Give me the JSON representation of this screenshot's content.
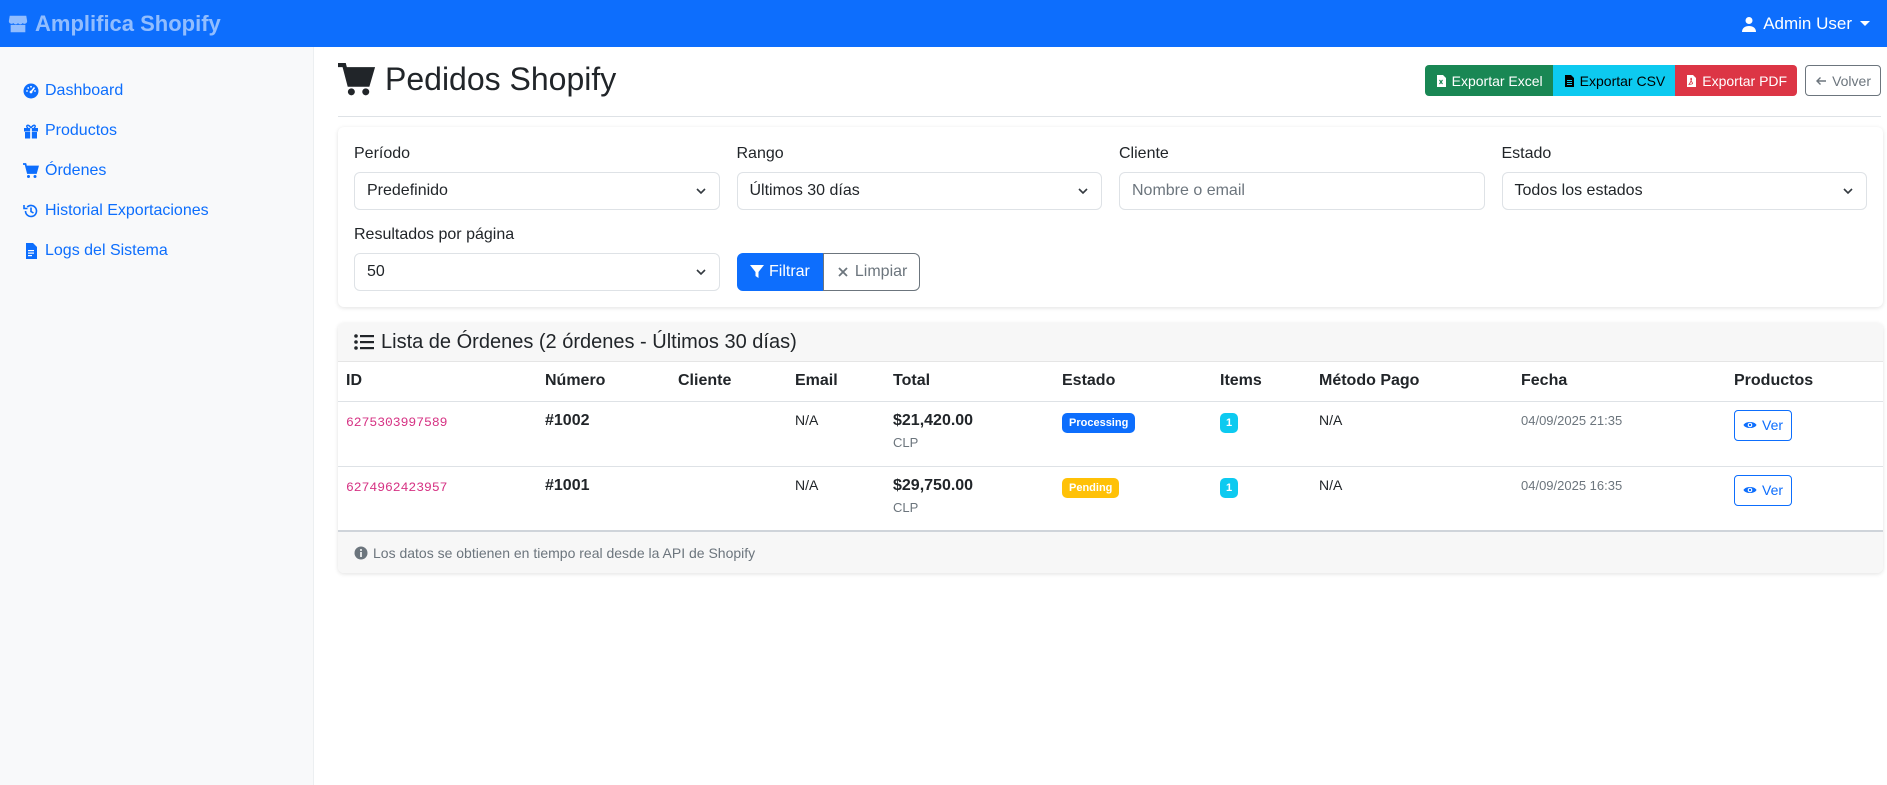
{
  "navbar": {
    "brand": "Amplifica Shopify",
    "user": "Admin User"
  },
  "sidebar": {
    "items": [
      {
        "label": "Dashboard",
        "icon": "gauge-icon"
      },
      {
        "label": "Productos",
        "icon": "gift-icon"
      },
      {
        "label": "Órdenes",
        "icon": "cart-icon"
      },
      {
        "label": "Historial Exportaciones",
        "icon": "history-icon"
      },
      {
        "label": "Logs del Sistema",
        "icon": "file-icon"
      }
    ]
  },
  "header": {
    "title": "Pedidos Shopify",
    "export_excel": "Exportar Excel",
    "export_csv": "Exportar CSV",
    "export_pdf": "Exportar PDF",
    "back": "Volver"
  },
  "filters": {
    "periodo": {
      "label": "Período",
      "value": "Predefinido"
    },
    "rango": {
      "label": "Rango",
      "value": "Últimos 30 días"
    },
    "cliente": {
      "label": "Cliente",
      "placeholder": "Nombre o email"
    },
    "estado": {
      "label": "Estado",
      "value": "Todos los estados"
    },
    "per_page": {
      "label": "Resultados por página",
      "value": "50"
    },
    "filter_button": "Filtrar",
    "clear_button": "Limpiar"
  },
  "orders": {
    "title": "Lista de Órdenes (2 órdenes - Últimos 30 días)",
    "columns": [
      "ID",
      "Número",
      "Cliente",
      "Email",
      "Total",
      "Estado",
      "Items",
      "Método Pago",
      "Fecha",
      "Productos"
    ],
    "rows": [
      {
        "id": "6275303997589",
        "number": "#1002",
        "customer": "",
        "email": "N/A",
        "total": "$21,420.00",
        "currency": "CLP",
        "status": "Processing",
        "items": "1",
        "payment": "N/A",
        "date": "04/09/2025 21:35",
        "action": "Ver"
      },
      {
        "id": "6274962423957",
        "number": "#1001",
        "customer": "",
        "email": "N/A",
        "total": "$29,750.00",
        "currency": "CLP",
        "status": "Pending",
        "items": "1",
        "payment": "N/A",
        "date": "04/09/2025 16:35",
        "action": "Ver"
      }
    ],
    "footer": "Los datos se obtienen en tiempo real desde la API de Shopify"
  },
  "colors": {
    "primary": "#0d6efd",
    "success": "#198754",
    "info": "#0dcaf0",
    "danger": "#dc3545",
    "warning": "#ffc107",
    "code_pink": "#d63384"
  }
}
